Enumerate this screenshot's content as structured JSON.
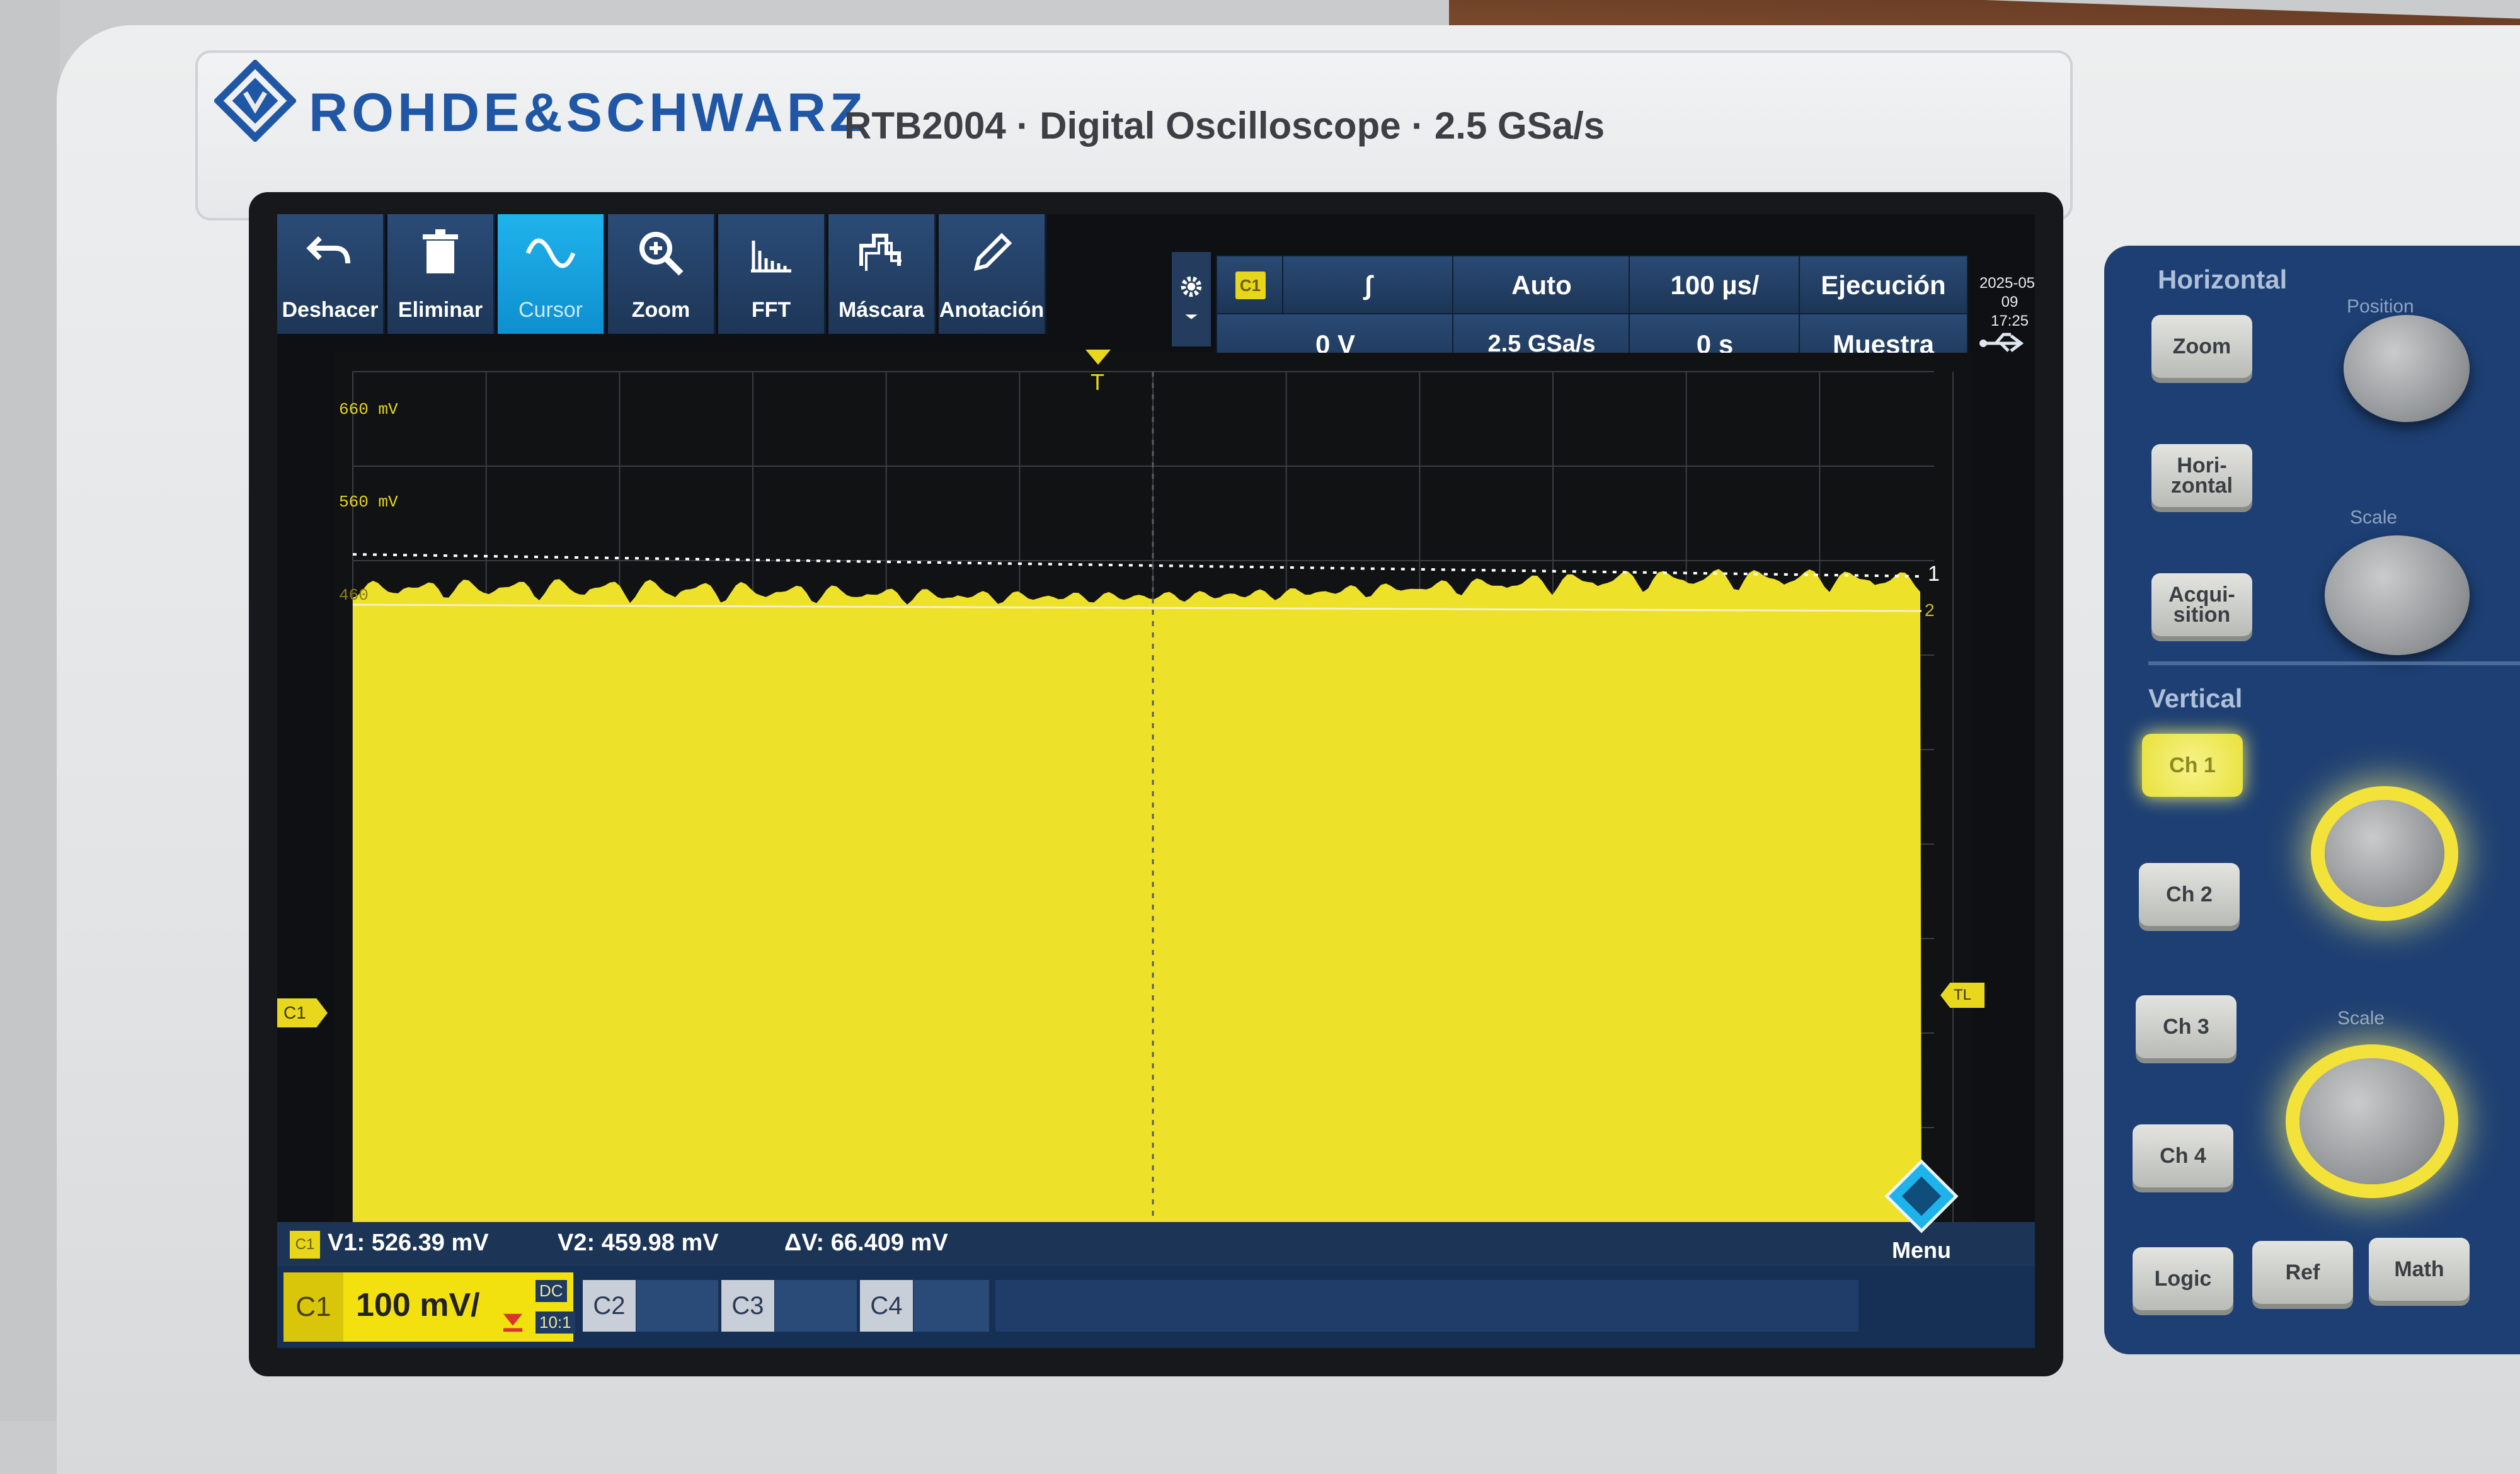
{
  "brand": {
    "name": "ROHDE&SCHWARZ",
    "model_line": "RTB2004 · Digital Oscilloscope · 2.5 GSa/s"
  },
  "toolbar": {
    "items": [
      {
        "label": "Deshacer",
        "icon": "undo-icon"
      },
      {
        "label": "Eliminar",
        "icon": "trash-icon"
      },
      {
        "label": "Cursor",
        "icon": "sine-wave-icon",
        "active": true
      },
      {
        "label": "Zoom",
        "icon": "magnifier-plus-icon"
      },
      {
        "label": "FFT",
        "icon": "spectrum-bars-icon"
      },
      {
        "label": "Máscara",
        "icon": "mask-icon"
      },
      {
        "label": "Anotación",
        "icon": "pencil-icon"
      }
    ]
  },
  "status": {
    "trigger_channel": "C1",
    "trigger_slope": "∫",
    "trigger_mode": "Auto",
    "time_base": "100 µs/",
    "run_state": "Ejecución",
    "trigger_level": "0 V",
    "sample_rate": "2.5 GSa/s",
    "time_offset": "0 s",
    "acquisition_mode": "Muestra",
    "date": "2025-05-09",
    "time": "17:25"
  },
  "plot": {
    "y_labels": [
      "660 mV",
      "560 mV",
      "460"
    ],
    "cursor_labels": [
      "1",
      "2"
    ],
    "channel_marker": "C1",
    "trigger_marker": "T",
    "time_ref_marker": "TL",
    "trace_color": "#eee12a"
  },
  "cursor_readout": {
    "channel": "C1",
    "v1": "V1: 526.39 mV",
    "v2": "V2: 459.98 mV",
    "dv": "ΔV: 66.409 mV"
  },
  "channels": {
    "c1": {
      "name": "C1",
      "scale": "100 mV/",
      "coupling": "DC",
      "probe": "10:1"
    },
    "c2": "C2",
    "c3": "C3",
    "c4": "C4",
    "menu": "Menu"
  },
  "panel": {
    "horizontal_title": "Horizontal",
    "vertical_title": "Vertical",
    "zoom": "Zoom",
    "horizontal": "Hori- zontal",
    "acquisition": "Acqui- sition",
    "position": "Position",
    "scale": "Scale",
    "ch1": "Ch 1",
    "ch2": "Ch 2",
    "ch3": "Ch 3",
    "ch4": "Ch 4",
    "logic": "Logic",
    "ref": "Ref",
    "math": "Math"
  },
  "colors": {
    "accent": "#1fb3ec",
    "channel1": "#eee12a",
    "panel": "#1d3f73"
  }
}
